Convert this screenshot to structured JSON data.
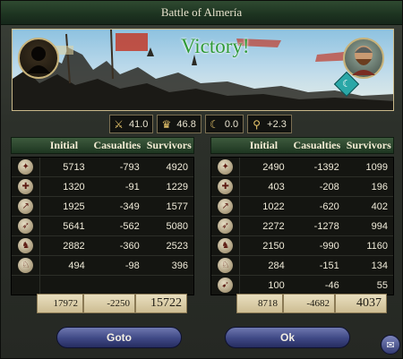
{
  "window": {
    "title": "Battle of Almería"
  },
  "banner": {
    "result": "Victory!",
    "badge_glyph": "☾"
  },
  "modifiers": [
    {
      "icon": "crossed-swords-icon",
      "glyph": "⚔",
      "value": "41.0"
    },
    {
      "icon": "crown-icon",
      "glyph": "♛",
      "value": "46.8"
    },
    {
      "icon": "crescent-icon",
      "glyph": "☾",
      "value": "0.0"
    },
    {
      "icon": "magnifier-sword-icon",
      "glyph": "⚲",
      "value": "+2.3"
    }
  ],
  "columns": {
    "initial": "Initial",
    "casualties": "Casualties",
    "survivors": "Survivors"
  },
  "left_side": {
    "rows": [
      {
        "unit_icon": "light-infantry-icon",
        "glyph": "✦",
        "initial": "5713",
        "casualties": "-793",
        "survivors": "4920"
      },
      {
        "unit_icon": "heavy-infantry-icon",
        "glyph": "✚",
        "initial": "1320",
        "casualties": "-91",
        "survivors": "1229"
      },
      {
        "unit_icon": "pikemen-icon",
        "glyph": "↗",
        "initial": "1925",
        "casualties": "-349",
        "survivors": "1577"
      },
      {
        "unit_icon": "archers-icon",
        "glyph": "➶",
        "initial": "5641",
        "casualties": "-562",
        "survivors": "5080"
      },
      {
        "unit_icon": "light-cavalry-icon",
        "glyph": "♞",
        "initial": "2882",
        "casualties": "-360",
        "survivors": "2523"
      },
      {
        "unit_icon": "knights-icon",
        "glyph": "♘",
        "initial": "494",
        "casualties": "-98",
        "survivors": "396"
      },
      {
        "unit_icon": "empty-icon",
        "glyph": "",
        "initial": "",
        "casualties": "",
        "survivors": ""
      }
    ],
    "totals": {
      "initial": "17972",
      "casualties": "-2250",
      "survivors": "15722"
    }
  },
  "right_side": {
    "rows": [
      {
        "unit_icon": "light-infantry-icon",
        "glyph": "✦",
        "initial": "2490",
        "casualties": "-1392",
        "survivors": "1099"
      },
      {
        "unit_icon": "heavy-infantry-icon",
        "glyph": "✚",
        "initial": "403",
        "casualties": "-208",
        "survivors": "196"
      },
      {
        "unit_icon": "pikemen-icon",
        "glyph": "↗",
        "initial": "1022",
        "casualties": "-620",
        "survivors": "402"
      },
      {
        "unit_icon": "archers-icon",
        "glyph": "➶",
        "initial": "2272",
        "casualties": "-1278",
        "survivors": "994"
      },
      {
        "unit_icon": "light-cavalry-icon",
        "glyph": "♞",
        "initial": "2150",
        "casualties": "-990",
        "survivors": "1160"
      },
      {
        "unit_icon": "knights-icon",
        "glyph": "♘",
        "initial": "284",
        "casualties": "-151",
        "survivors": "134"
      },
      {
        "unit_icon": "horse-archers-icon",
        "glyph": "➹",
        "initial": "100",
        "casualties": "-46",
        "survivors": "55"
      }
    ],
    "totals": {
      "initial": "8718",
      "casualties": "-4682",
      "survivors": "4037"
    }
  },
  "buttons": {
    "goto": "Goto",
    "ok": "Ok"
  },
  "colors": {
    "victory": "#2e9a37",
    "button": "#3e4784",
    "header": "#1e3621"
  }
}
